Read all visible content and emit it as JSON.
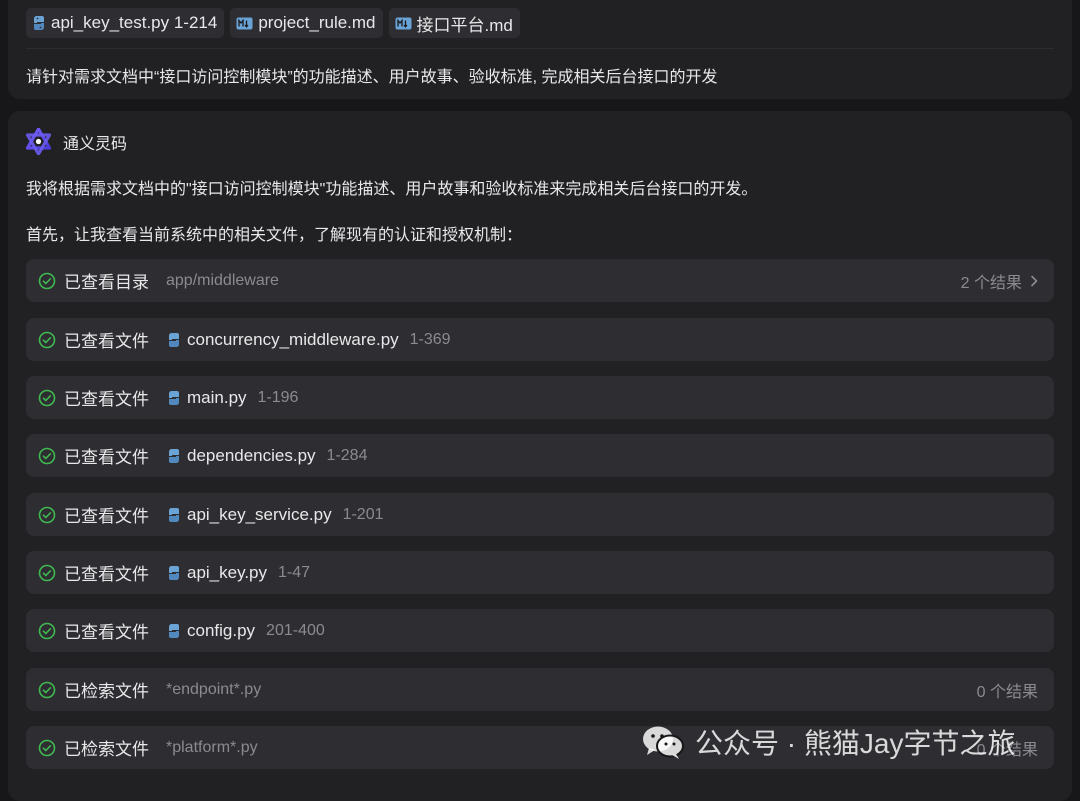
{
  "user_message": {
    "attachments": [
      {
        "icon": "python-file-icon",
        "label": "api_key_test.py 1-214"
      },
      {
        "icon": "markdown-file-icon",
        "label": "project_rule.md"
      },
      {
        "icon": "markdown-file-icon",
        "label": "接口平台.md"
      }
    ],
    "prompt": "请针对需求文档中“接口访问控制模块”的功能描述、用户故事、验收标准, 完成相关后台接口的开发"
  },
  "assistant": {
    "name": "通义灵码",
    "logo_icon": "tongyi-lingma-logo-icon",
    "paragraphs": [
      "我将根据需求文档中的\"接口访问控制模块\"功能描述、用户故事和验收标准来完成相关后台接口的开发。",
      "首先，让我查看当前系统中的相关文件，了解现有的认证和授权机制："
    ],
    "steps": [
      {
        "action": "已查看目录",
        "kind": "dir",
        "path": "app/middleware",
        "result": "2 个结果",
        "expandable": true
      },
      {
        "action": "已查看文件",
        "kind": "file",
        "file": "concurrency_middleware.py",
        "range": "1-369"
      },
      {
        "action": "已查看文件",
        "kind": "file",
        "file": "main.py",
        "range": "1-196"
      },
      {
        "action": "已查看文件",
        "kind": "file",
        "file": "dependencies.py",
        "range": "1-284"
      },
      {
        "action": "已查看文件",
        "kind": "file",
        "file": "api_key_service.py",
        "range": "1-201"
      },
      {
        "action": "已查看文件",
        "kind": "file",
        "file": "api_key.py",
        "range": "1-47"
      },
      {
        "action": "已查看文件",
        "kind": "file",
        "file": "config.py",
        "range": "201-400"
      },
      {
        "action": "已检索文件",
        "kind": "search",
        "path": "*endpoint*.py",
        "result": "0 个结果"
      },
      {
        "action": "已检索文件",
        "kind": "search",
        "path": "*platform*.py",
        "result": "0 个结果"
      }
    ]
  },
  "watermark": {
    "text": "公众号 · 熊猫Jay字节之旅",
    "icon": "wechat-icon"
  },
  "colors": {
    "background": "#17171a",
    "card": "#212124",
    "step_row": "#2e2e32",
    "success_green": "#3fb950",
    "python_blue": "#6aa3d6",
    "muted_text": "#8a8a90"
  }
}
